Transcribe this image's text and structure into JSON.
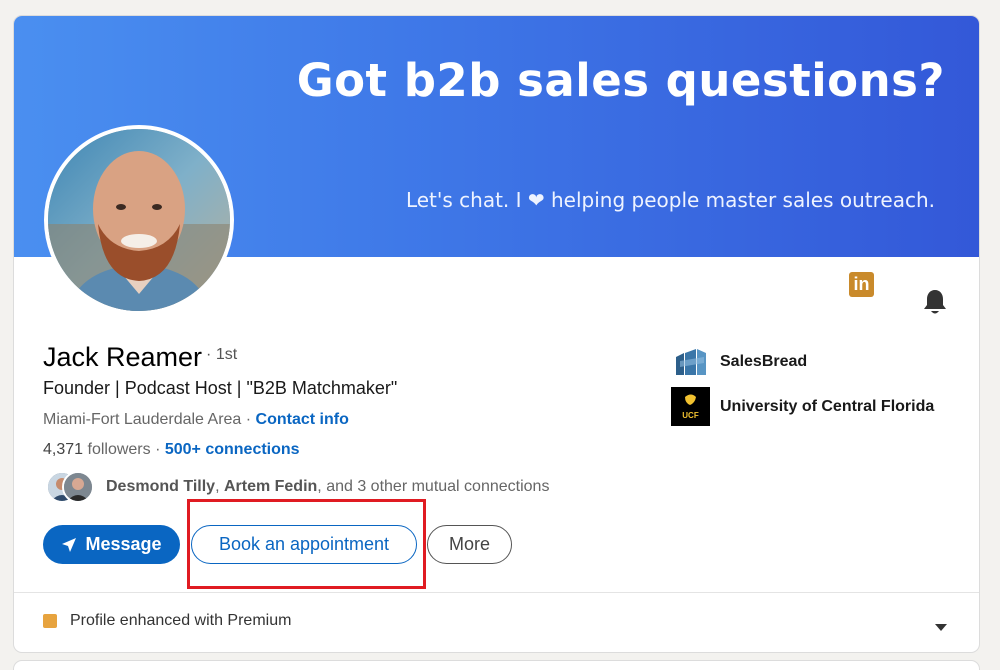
{
  "banner": {
    "title": "Got b2b sales questions?",
    "subtitle": "Let's chat. I ❤ helping people master sales outreach."
  },
  "profile": {
    "name": "Jack Reamer",
    "degree": "· 1st",
    "headline": "Founder | Podcast Host | \"B2B Matchmaker\"",
    "location": "Miami-Fort Lauderdale Area",
    "location_sep": " · ",
    "contact_info": "Contact info",
    "followers_count": "4,371",
    "followers_label": " followers",
    "stats_sep": "  · ",
    "connections": "500+ connections",
    "mutual": {
      "name1": "Desmond Tilly",
      "sep": ", ",
      "name2": "Artem Fedin",
      "rest": ", and 3 other mutual connections"
    }
  },
  "actions": {
    "message": "Message",
    "book": "Book an appointment",
    "more": "More"
  },
  "orgs": {
    "company": "SalesBread",
    "school": "University of Central Florida",
    "school_logo_text": "UCF"
  },
  "badges": {
    "linkedin_text": "in"
  },
  "premium": {
    "label": "Profile enhanced with Premium"
  },
  "colors": {
    "primary": "#0a66c2",
    "banner_start": "#4a8ff0",
    "banner_end": "#3358d8",
    "highlight": "#e01b22",
    "premium": "#e7a33e"
  }
}
